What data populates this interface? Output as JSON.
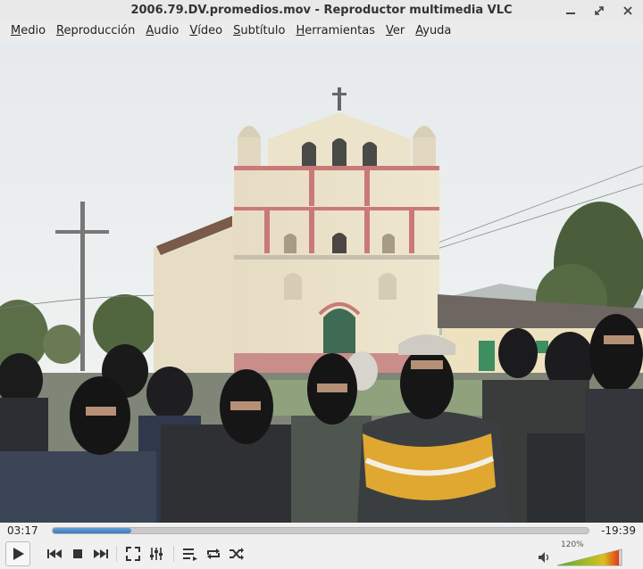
{
  "window": {
    "title": "2006.79.DV.promedios.mov - Reproductor multimedia VLC"
  },
  "menu": [
    {
      "label": "Medio",
      "acc": "M",
      "rest": "edio"
    },
    {
      "label": "Reproducción",
      "acc": "R",
      "rest": "eproducción"
    },
    {
      "label": "Audio",
      "acc": "A",
      "rest": "udio"
    },
    {
      "label": "Vídeo",
      "acc": "V",
      "rest": "ídeo"
    },
    {
      "label": "Subtítulo",
      "acc": "S",
      "rest": "ubtítulo"
    },
    {
      "label": "Herramientas",
      "acc": "H",
      "rest": "erramientas"
    },
    {
      "label": "Ver",
      "acc": "V",
      "rest": "er"
    },
    {
      "label": "Ayuda",
      "acc": "A",
      "rest": "yuda"
    }
  ],
  "playback": {
    "elapsed": "03:17",
    "remaining": "-19:39",
    "progress": 0.146
  },
  "volume": {
    "label": "120%",
    "level": 1.2
  },
  "colors": {
    "accent": "#3a78c0",
    "volume_low": "#4caf2a",
    "volume_high": "#e23a1a"
  }
}
